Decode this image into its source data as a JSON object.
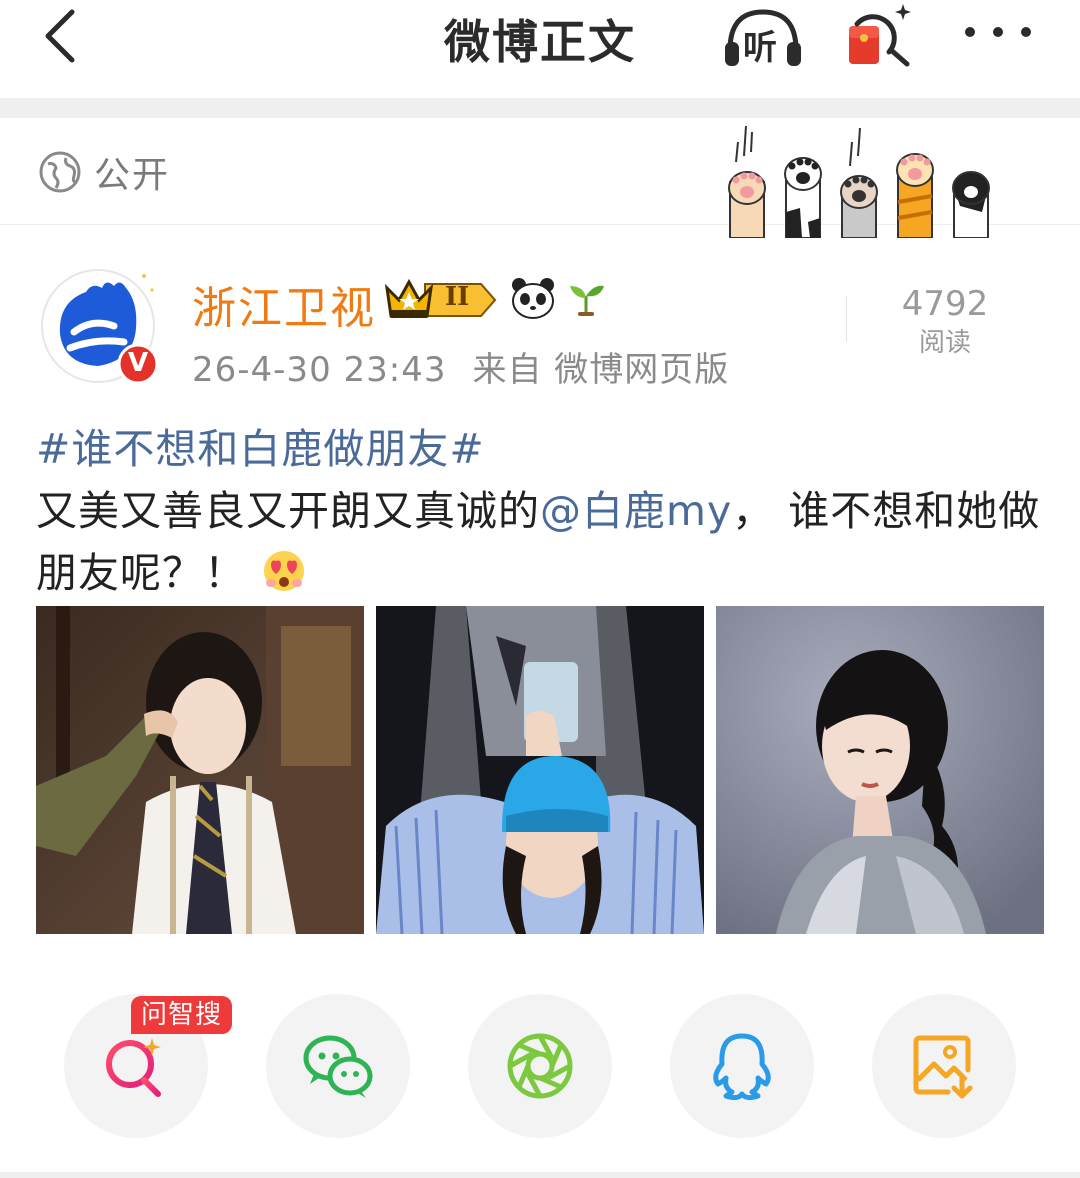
{
  "header": {
    "title": "微博正文",
    "listen_label": "听",
    "back_icon": "chevron-left-icon",
    "more_icon": "more-dots-icon"
  },
  "visibility": {
    "label": "公开",
    "icon": "globe-icon"
  },
  "author": {
    "name": "浙江卫视",
    "crown_badge_level": "II",
    "verified_mark": "V",
    "time": "26-4-30 23:43",
    "source": "来自 微博网页版"
  },
  "stats": {
    "read_count": "4792",
    "read_label": "阅读"
  },
  "post": {
    "topic": "#谁不想和白鹿做朋友#",
    "text_before_mention": "又美又善良又开朗又真诚的",
    "mention": "@白鹿my",
    "text_after_mention": "， 谁不想和她做朋友呢？！"
  },
  "share": {
    "ai_tag": "问智搜",
    "items": [
      "ai-search-icon",
      "wechat-icon",
      "moments-icon",
      "qq-icon",
      "save-image-icon"
    ]
  },
  "colors": {
    "accent_orange": "#f07b13",
    "link_blue": "#4a6a9a",
    "tag_red": "#ee3a3a"
  }
}
